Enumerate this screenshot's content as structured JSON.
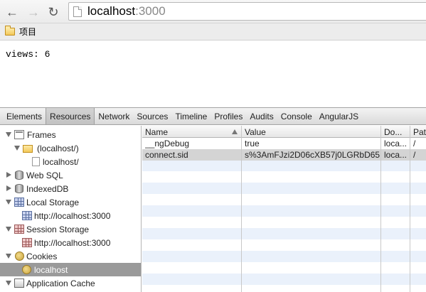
{
  "browser": {
    "url_host": "localhost",
    "url_port": ":3000",
    "bookmark_label": "项目"
  },
  "page": {
    "views_text": "views: 6"
  },
  "devtools": {
    "tabs": [
      "Elements",
      "Resources",
      "Network",
      "Sources",
      "Timeline",
      "Profiles",
      "Audits",
      "Console",
      "AngularJS"
    ],
    "active_tab": "Resources",
    "tree": {
      "frames": "Frames",
      "frame_localhost": "(localhost/)",
      "frame_doc": "localhost/",
      "websql": "Web SQL",
      "indexeddb": "IndexedDB",
      "local_storage": "Local Storage",
      "local_storage_origin": "http://localhost:3000",
      "session_storage": "Session Storage",
      "session_storage_origin": "http://localhost:3000",
      "cookies": "Cookies",
      "cookies_host": "localhost",
      "app_cache": "Application Cache"
    },
    "cookie_table": {
      "headers": {
        "name": "Name",
        "value": "Value",
        "domain": "Do...",
        "path": "Pat"
      },
      "rows": [
        {
          "name": "__ngDebug",
          "value": "true",
          "domain": "loca...",
          "path": "/"
        },
        {
          "name": "connect.sid",
          "value": "s%3AmFJzi2D06cXB57j0LGRbD65...",
          "domain": "loca...",
          "path": "/"
        }
      ]
    }
  }
}
